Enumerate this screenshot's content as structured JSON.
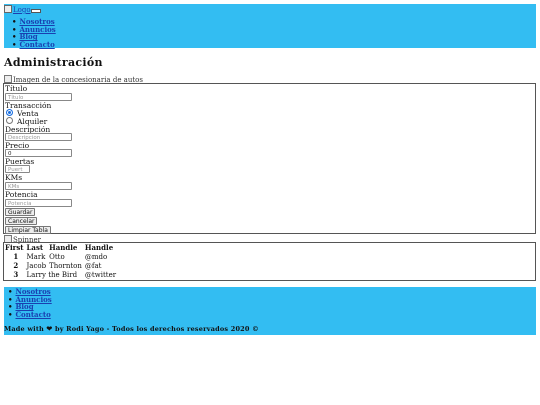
{
  "header": {
    "logo_alt": "Logo",
    "nav": [
      "Nosotros",
      "Anuncios",
      "Blog",
      "Contacto"
    ]
  },
  "main": {
    "title": "Administración",
    "car_image_alt": "Imagen de la concesionaria de autos",
    "form": {
      "titulo_label": "Título",
      "titulo_placeholder": "Título",
      "transaccion_label": "Transacción",
      "transaccion_options": [
        "Venta",
        "Alquiler"
      ],
      "transaccion_selected": "Venta",
      "descripcion_label": "Descripción",
      "descripcion_placeholder": "Descripcion",
      "precio_label": "Precio",
      "precio_value": "0",
      "puertas_label": "Puertas",
      "puertas_placeholder": "Puert",
      "kms_label": "KMs",
      "kms_placeholder": "KMs",
      "potencia_label": "Potencia",
      "potencia_placeholder": "Potencia",
      "guardar": "Guardar",
      "cancelar": "Cancelar",
      "limpiar": "Limpiar Tabla"
    },
    "spinner_alt": "Spinner",
    "table": {
      "headers": [
        "First",
        "Last",
        "Handle",
        "Handle"
      ],
      "rows": [
        {
          "num": "1",
          "first": "Mark",
          "last": "Otto",
          "handle": "@mdo"
        },
        {
          "num": "2",
          "first": "Jacob",
          "last": "Thornton",
          "handle": "@fat"
        },
        {
          "num": "3",
          "first": "Larry the Bird",
          "last": "",
          "handle": "@twitter"
        }
      ]
    }
  },
  "footer": {
    "nav": [
      "Nosotros",
      "Anuncios",
      "Blog",
      "Contacto"
    ],
    "credit_pre": "Made with",
    "credit_post": "by Rodi Yago - Todos los derechos reservados 2020 ©"
  },
  "colors": {
    "accent": "#33bdf2",
    "link": "#1a3fb0"
  },
  "icons": {
    "heart": "heart-icon"
  }
}
